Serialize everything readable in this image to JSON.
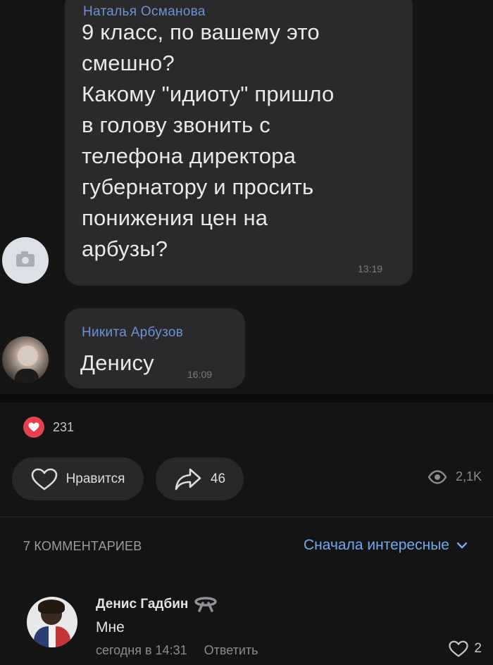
{
  "screenshot": {
    "message1": {
      "sender": "Наталья Османова",
      "text": "9 класс, по вашему это\nсмешно?\nКакому \"идиоту\" пришло\nв голову звонить с\nтелефона директора\nгубернатору и просить\nпонижения цен на\nарбузы?",
      "time": "13:19"
    },
    "message2": {
      "sender": "Никита Арбузов",
      "text": "Денису",
      "time": "16:09"
    }
  },
  "reactions": {
    "count": "231",
    "icon": "heart-icon",
    "color": "#e6404d"
  },
  "actions": {
    "like_label": "Нравится",
    "share_count": "46",
    "views": "2,1K"
  },
  "comments": {
    "count_label": "7 КОММЕНТАРИЕВ",
    "sort_label": "Сначала интересные",
    "accent": "#71aaeb",
    "items": [
      {
        "author": "Денис Гадбин",
        "text": "Мне",
        "date": "сегодня в 14:31",
        "reply_label": "Ответить",
        "likes": "2"
      }
    ]
  }
}
